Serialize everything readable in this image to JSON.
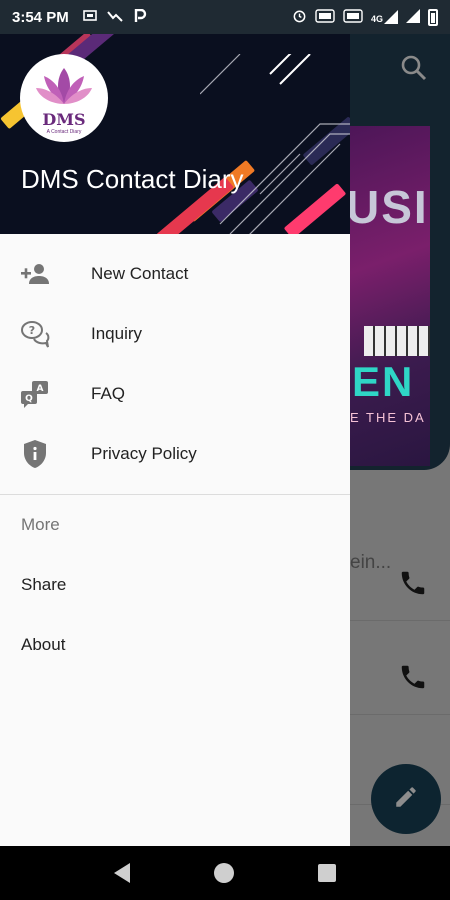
{
  "status_bar": {
    "time": "3:54 PM",
    "icons": [
      "screen-share-icon",
      "trend-down-icon",
      "parking-icon"
    ],
    "right_icons": [
      "alarm-icon",
      "volte-icon",
      "volte-icon",
      "signal-4g-icon",
      "signal-icon",
      "battery-icon"
    ],
    "network_label": "4G"
  },
  "background_app": {
    "banner_word_top": "USI",
    "banner_word_bottom": "EN",
    "banner_tagline": "E THE DA",
    "list_snippet": "ein...",
    "accent_color": "#0d2430"
  },
  "drawer": {
    "logo_text": "DMS",
    "logo_subtext": "A Contact Diary",
    "title": "DMS Contact Diary",
    "items": [
      {
        "label": "New Contact",
        "icon": "person-add-icon"
      },
      {
        "label": "Inquiry",
        "icon": "question-chat-icon"
      },
      {
        "label": "FAQ",
        "icon": "qa-chat-icon"
      },
      {
        "label": "Privacy Policy",
        "icon": "shield-icon"
      }
    ],
    "section_title": "More",
    "more_items": [
      {
        "label": "Share"
      },
      {
        "label": "About"
      }
    ]
  }
}
